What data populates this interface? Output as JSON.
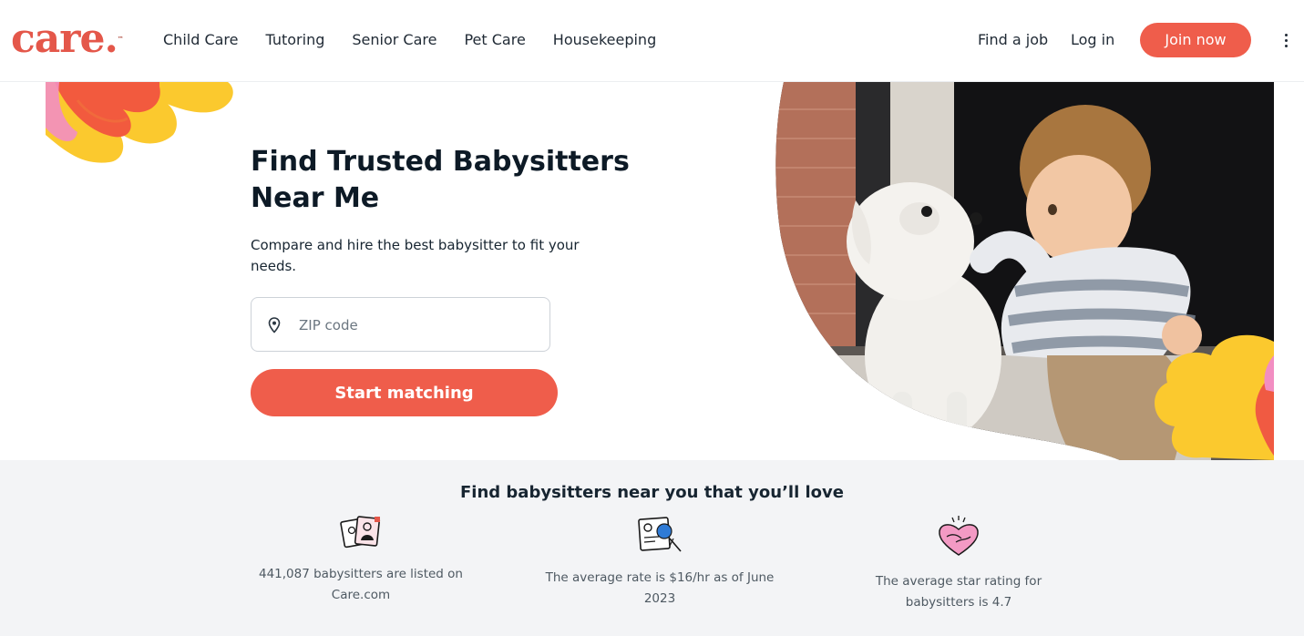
{
  "brand": {
    "logo_text": "care.",
    "tm": "™",
    "accent": "#ef5d4b"
  },
  "nav": {
    "items": [
      "Child Care",
      "Tutoring",
      "Senior Care",
      "Pet Care",
      "Housekeeping"
    ],
    "find_job": "Find a job",
    "login": "Log in",
    "join": "Join now"
  },
  "hero": {
    "title_line1": "Find Trusted Babysitters",
    "title_line2": "Near Me",
    "subtitle": "Compare and hire the best babysitter to fit your needs.",
    "zip_placeholder": "ZIP code",
    "zip_value": "",
    "cta": "Start matching",
    "photo": "toddler-petting-white-dog"
  },
  "stats": {
    "heading": "Find babysitters near you that you’ll love",
    "items": [
      {
        "icon": "profiles-icon",
        "text": "441,087 babysitters are listed on Care.com"
      },
      {
        "icon": "certificate-icon",
        "text": "The average rate is $16/hr as of June 2023"
      },
      {
        "icon": "heart-handshake-icon",
        "text": "The average star rating for babysitters is 4.7"
      }
    ]
  }
}
